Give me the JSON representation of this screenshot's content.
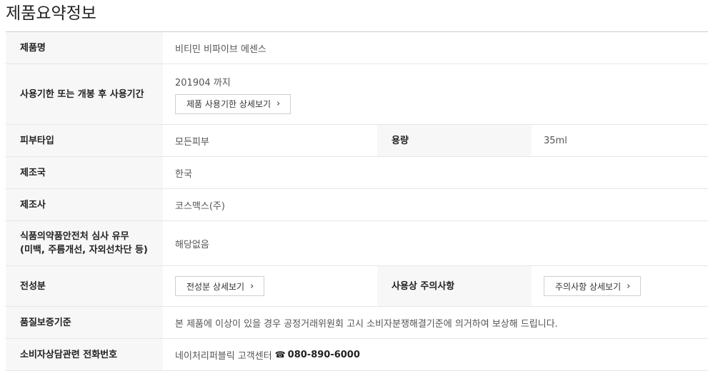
{
  "title": "제품요약정보",
  "rows": {
    "product_name": {
      "label": "제품명",
      "value": "비티민 비파이브 에센스"
    },
    "expiry": {
      "label": "사용기한 또는 개봉 후 사용기간",
      "value": "201904 까지",
      "button": "제품 사용기한 상세보기"
    },
    "skin_type": {
      "label": "피부타입",
      "value": "모든피부",
      "label2": "용량",
      "value2": "35ml"
    },
    "country": {
      "label": "제조국",
      "value": "한국"
    },
    "maker": {
      "label": "제조사",
      "value": "코스맥스(주)"
    },
    "review": {
      "label_line1": "식품의약품안전처 심사 유무",
      "label_line2": "(미백, 주름개선, 자외선차단 등)",
      "value": "해당없음"
    },
    "ingredients": {
      "label": "전성분",
      "button": "전성분 상세보기",
      "label2": "사용상 주의사항",
      "button2": "주의사항 상세보기"
    },
    "warranty": {
      "label": "품질보증기준",
      "value": "본 제품에 이상이 있을 경우 공정거래위원회 고시 소비자분쟁해결기준에 의거하여 보상해 드립니다."
    },
    "consult": {
      "label": "소비자상담관련 전화번호",
      "value": "네이처리퍼블릭 고객센터",
      "phone_icon": "☎",
      "phone": "080-890-6000"
    }
  }
}
